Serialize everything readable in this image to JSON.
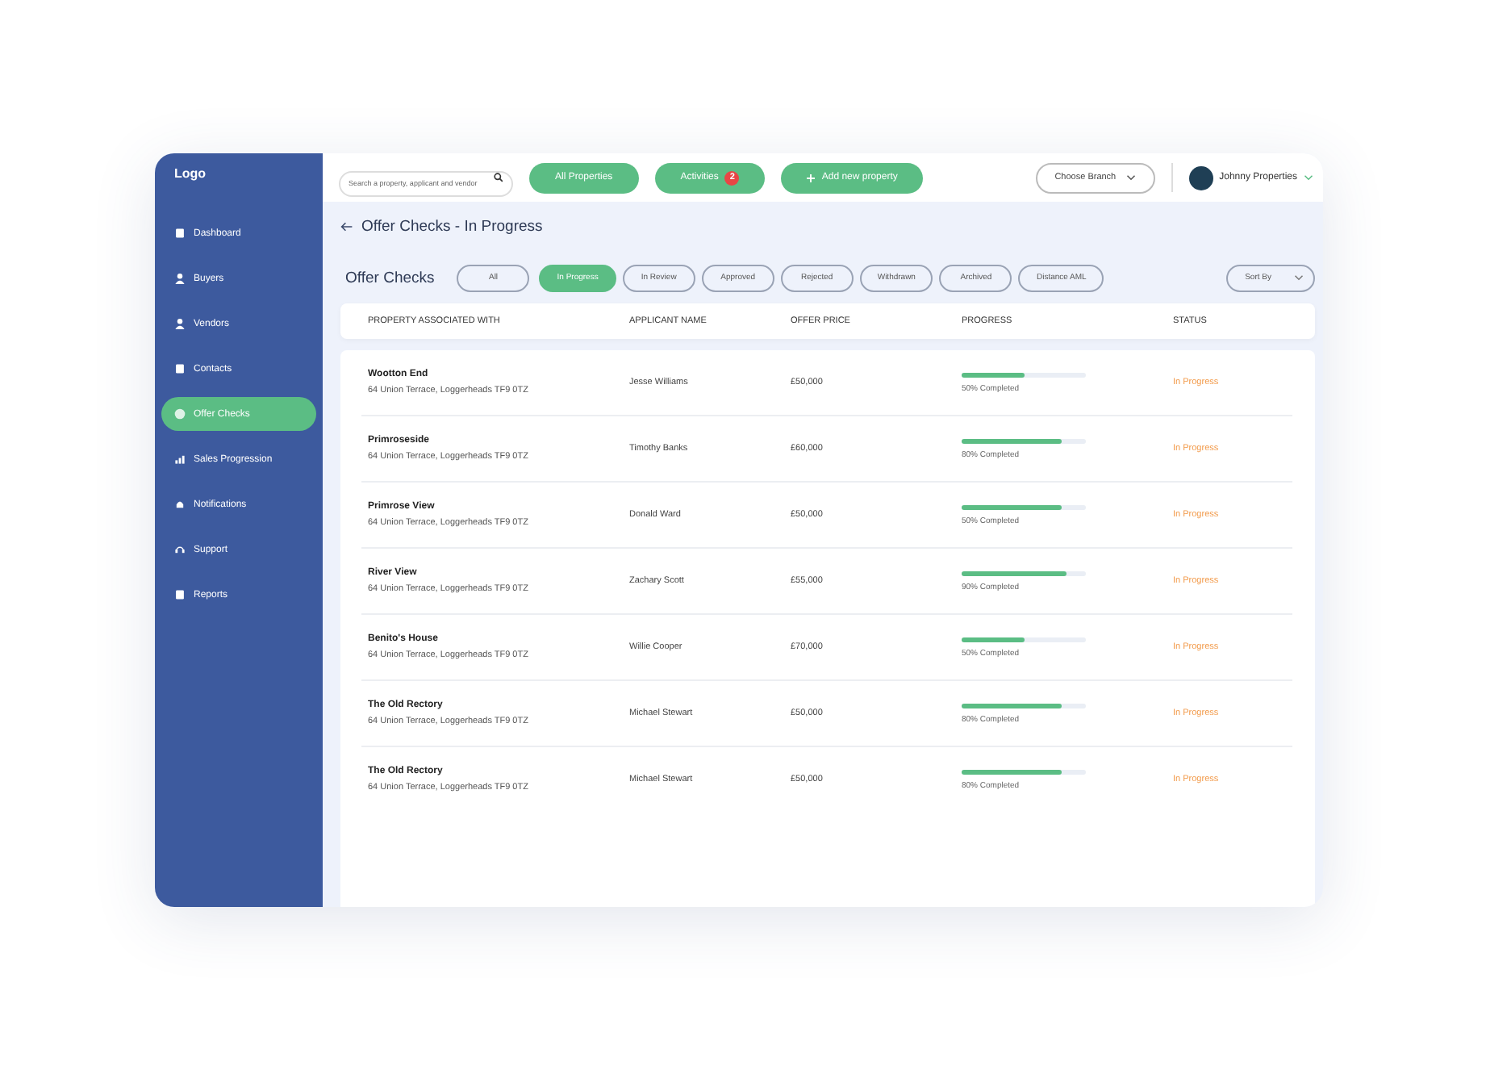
{
  "sidebar": {
    "logo": "Logo",
    "items": [
      {
        "label": "Dashboard",
        "selected": false
      },
      {
        "label": "Buyers",
        "selected": false
      },
      {
        "label": "Vendors",
        "selected": false
      },
      {
        "label": "Contacts",
        "selected": false
      },
      {
        "label": "Offer Checks",
        "selected": true
      },
      {
        "label": "Sales Progression",
        "selected": false
      },
      {
        "label": "Notifications",
        "selected": false
      },
      {
        "label": "Support",
        "selected": false
      },
      {
        "label": "Reports",
        "selected": false
      }
    ]
  },
  "topbar": {
    "search": {
      "placeholder": "Search a property, applicant and vendor"
    },
    "buttons": [
      {
        "label": "All Properties"
      },
      {
        "label": "Activities",
        "badge": "2"
      },
      {
        "label": "Add new property"
      }
    ],
    "branch": "Choose Branch",
    "account": "Johnny Properties"
  },
  "page_title": "Offer Checks - In Progress",
  "section_title": "Offer Checks",
  "filters": [
    {
      "label": "All",
      "selected": false
    },
    {
      "label": "In Progress",
      "selected": true
    },
    {
      "label": "In Review",
      "selected": false
    },
    {
      "label": "Approved",
      "selected": false
    },
    {
      "label": "Rejected",
      "selected": false
    },
    {
      "label": "Withdrawn",
      "selected": false
    },
    {
      "label": "Archived",
      "selected": false
    },
    {
      "label": "Distance AML",
      "selected": false
    }
  ],
  "sort": "Sort By",
  "table": {
    "columns": [
      "PROPERTY ASSOCIATED WITH",
      "APPLICANT NAME",
      "OFFER PRICE",
      "PROGRESS",
      "STATUS"
    ],
    "rows": [
      {
        "property": "Wootton End",
        "address": "64  Union Terrace, Loggerheads TF9 0TZ",
        "applicant": "Jesse Williams",
        "price": "£50,000",
        "level": 0.5,
        "progress": "50% Completed",
        "status": "In Progress"
      },
      {
        "property": "Primroseside",
        "address": "64  Union Terrace, Loggerheads TF9 0TZ",
        "applicant": "Timothy Banks",
        "price": "£60,000",
        "level": 0.8,
        "progress": "80% Completed",
        "status": "In Progress"
      },
      {
        "property": "Primrose View",
        "address": "64  Union Terrace, Loggerheads TF9 0TZ",
        "applicant": "Donald Ward",
        "price": "£50,000",
        "level": 0.8,
        "progress": "50% Completed",
        "status": "In Progress"
      },
      {
        "property": "River View",
        "address": "64  Union Terrace, Loggerheads TF9 0TZ",
        "applicant": "Zachary Scott",
        "price": "£55,000",
        "level": 0.85,
        "progress": "90% Completed",
        "status": "In Progress"
      },
      {
        "property": "Benito's House",
        "address": "64  Union Terrace, Loggerheads TF9 0TZ",
        "applicant": "Willie Cooper",
        "price": "£70,000",
        "level": 0.5,
        "progress": "50% Completed",
        "status": "In Progress"
      },
      {
        "property": "The Old Rectory",
        "address": "64  Union Terrace, Loggerheads TF9 0TZ",
        "applicant": "Michael Stewart",
        "price": "£50,000",
        "level": 0.8,
        "progress": "80% Completed",
        "status": "In Progress"
      },
      {
        "property": "The Old Rectory",
        "address": "64  Union Terrace, Loggerheads TF9 0TZ",
        "applicant": "Michael Stewart",
        "price": "£50,000",
        "level": 0.8,
        "progress": "80% Completed",
        "status": "In Progress"
      }
    ]
  }
}
